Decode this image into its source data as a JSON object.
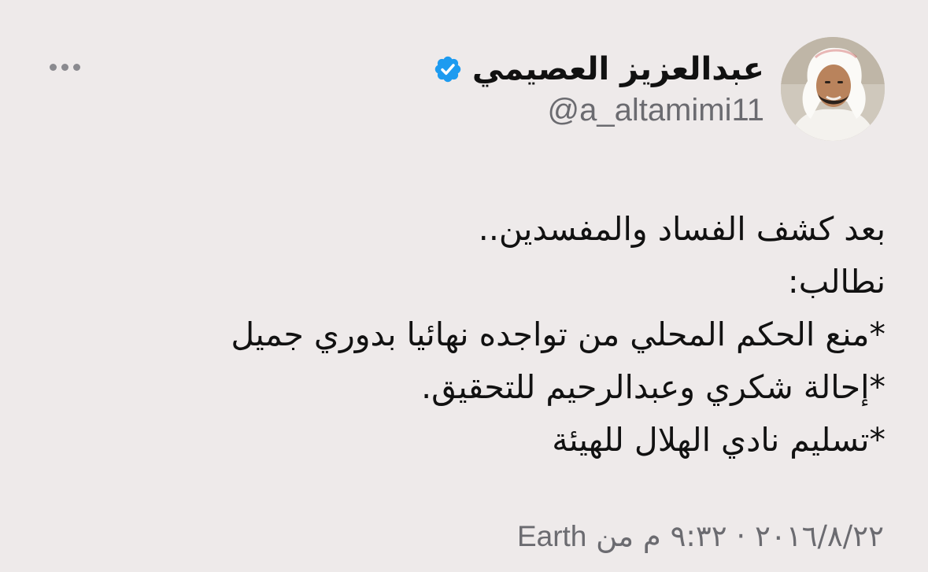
{
  "user": {
    "display_name": "عبدالعزيز العصيمي",
    "handle": "@a_altamimi11",
    "verified": true,
    "avatar_icon": "profile-photo"
  },
  "menu": {
    "icon": "more-horizontal-icon"
  },
  "tweet": {
    "lines": [
      "بعد كشف الفساد والمفسدين..",
      "نطالب:",
      "*منع الحكم المحلي من تواجده نهائيا بدوري جميل",
      "*إحالة شكري وعبدالرحيم للتحقيق.",
      "*تسليم نادي الهلال للهيئة"
    ]
  },
  "meta": {
    "date": "٢٠١٦/٨/٢٢",
    "separator": "·",
    "time": "٩:٣٢ م",
    "from_label": "من",
    "source": "Earth"
  },
  "colors": {
    "background": "#eeeaea",
    "text": "#111111",
    "secondary": "#6b6b70",
    "verified": "#1d9bf0"
  }
}
